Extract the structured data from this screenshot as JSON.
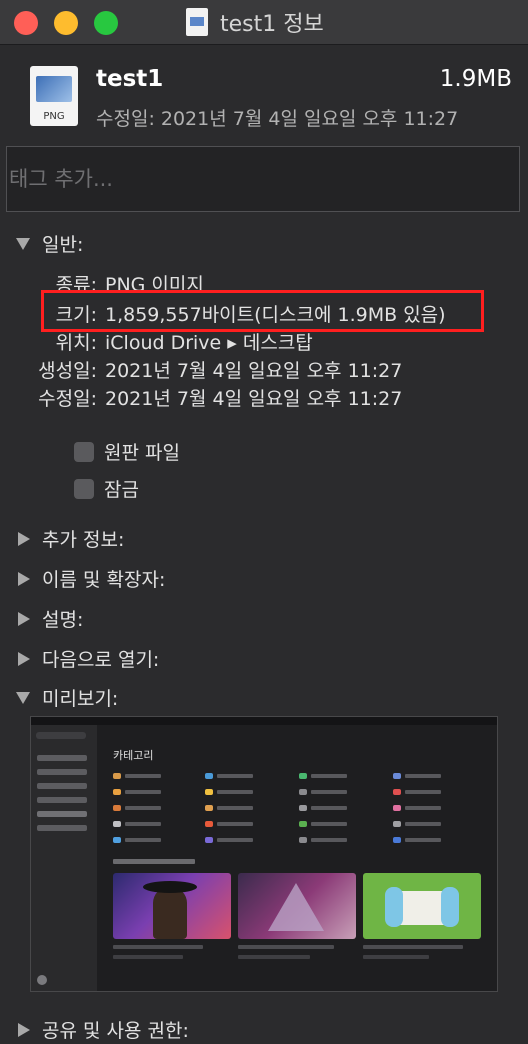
{
  "window": {
    "title": "test1 정보"
  },
  "header": {
    "file_name": "test1",
    "file_size": "1.9MB",
    "modified": "수정일: 2021년 7월 4일 일요일 오후 11:27",
    "icon_ext": "PNG"
  },
  "tags": {
    "placeholder": "태그 추가..."
  },
  "general": {
    "title": "일반:",
    "kind_label": "종류:",
    "kind_value": "PNG 이미지",
    "size_label": "크기:",
    "size_value": "1,859,557바이트(디스크에 1.9MB 있음)",
    "where_label": "위치:",
    "where_value": "iCloud Drive ▸ 데스크탑",
    "created_label": "생성일:",
    "created_value": "2021년 7월 4일 일요일 오후 11:27",
    "modified_label": "수정일:",
    "modified_value": "2021년 7월 4일 일요일 오후 11:27",
    "stationery_label": "원판 파일",
    "locked_label": "잠금"
  },
  "sections": {
    "more_info": "추가 정보:",
    "name_ext": "이름 및 확장자:",
    "comments": "설명:",
    "open_with": "다음으로 열기:",
    "preview": "미리보기:",
    "sharing": "공유 및 사용 권한:"
  },
  "preview": {
    "heading": "카테고리"
  },
  "colors": {
    "highlight": "#ff1f1f",
    "background": "#2b2b2d"
  }
}
